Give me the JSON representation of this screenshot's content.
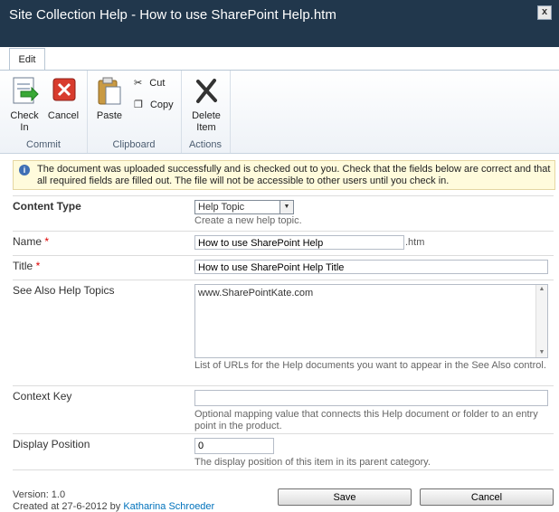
{
  "window": {
    "title": "Site Collection Help - How to use SharePoint Help.htm",
    "close": "x"
  },
  "ribbon": {
    "tab": "Edit",
    "groups": {
      "commit": "Commit",
      "clipboard": "Clipboard",
      "actions": "Actions"
    },
    "check_in": [
      "Check",
      "In"
    ],
    "cancel": "Cancel",
    "paste": "Paste",
    "cut": "Cut",
    "copy": "Copy",
    "delete": [
      "Delete",
      "Item"
    ]
  },
  "message": {
    "icon": "info-icon",
    "text": "The document was uploaded successfully and is checked out to you. Check that the fields below are correct and that all required fields are filled out. The file will not be accessible to other users until you check in."
  },
  "form": {
    "content_type": {
      "label": "Content Type",
      "value": "Help Topic",
      "desc": "Create a new help topic."
    },
    "name": {
      "label": "Name",
      "required": "*",
      "value": "How to use SharePoint Help",
      "suffix": ".htm"
    },
    "title": {
      "label": "Title",
      "required": "*",
      "value": "How to use SharePoint Help Title"
    },
    "see_also": {
      "label": "See Also Help Topics",
      "value": "www.SharePointKate.com",
      "desc": "List of URLs for the Help documents you want to appear in the See Also control."
    },
    "context_key": {
      "label": "Context Key",
      "value": "",
      "desc": "Optional mapping value that connects this Help document or folder to an entry point in the product."
    },
    "display_position": {
      "label": "Display Position",
      "value": "0",
      "desc": "The display position of this item in its parent category."
    }
  },
  "footer": {
    "version": "Version: 1.0",
    "created_prefix": "Created at 27-6-2012 by",
    "created_by": "Katharina Schroeder",
    "save": "Save",
    "cancel": "Cancel"
  },
  "colors": {
    "titlebar": "#21374c",
    "link": "#0072bc",
    "required": "#dd0000"
  }
}
